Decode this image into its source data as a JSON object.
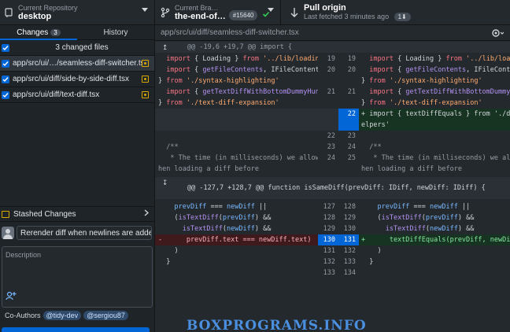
{
  "toolbar": {
    "repo_label": "Current Repository",
    "repo_name": "desktop",
    "branch_label": "Current Bra…",
    "branch_name": "the-end-of…",
    "pr_number": "#15640",
    "pull_title": "Pull origin",
    "pull_subtitle": "Last fetched 3 minutes ago",
    "pull_badge": "1⬇"
  },
  "sidebar": {
    "tabs": [
      {
        "label": "Changes",
        "count": "3"
      },
      {
        "label": "History"
      }
    ],
    "changed_header": "3 changed files",
    "files": [
      {
        "name": "app/src/ui/…/seamless-diff-switcher.tsx"
      },
      {
        "name": "app/src/ui/diff/side-by-side-diff.tsx"
      },
      {
        "name": "app/src/ui/diff/text-diff.tsx"
      }
    ],
    "stashed_label": "Stashed Changes",
    "summary_value": "Rerender diff when newlines are adde",
    "description_placeholder": "Description",
    "coauthors_label": "Co-Authors",
    "coauthors": [
      "@tidy-dev",
      "@sergiou87"
    ]
  },
  "diff": {
    "path": "app/src/ui/diff/seamless-diff-switcher.tsx",
    "hunk1": "@@ -19,6 +19,7 @@ import {",
    "hunk2": "@@ -127,7 +128,7 @@ function isSameDiff(prevDiff: IDiff, newDiff: IDiff) {",
    "watermark": "BOXPROGRAMS.INFO",
    "lines": {
      "l1_left": "  import { Loading } from '../lib/loading'",
      "l1_right": "  import { Loading } from '../lib/loading'",
      "l2_left": "  import { getFileContents, IFileContents",
      "l2b_left": "} from './syntax-highlighting'",
      "l2_right": "  import { getFileContents, IFileContents",
      "l2b_right": "} from './syntax-highlighting'",
      "l3_left": "  import { getTextDiffWithBottomDummyHunk",
      "l3b_left": "} from './text-diff-expansion'",
      "l3_right": "  import { getTextDiffWithBottomDummyHunk",
      "l3b_right": "} from './text-diff-expansion'",
      "add1_right": "+ import { textDiffEquals } from './dif",
      "add1b_right": "elpers'",
      "c1_left": "  /**",
      "c1_right": "  /**",
      "c2_left": "   * The time (in milliseconds) we allow w",
      "c2b_left": "hen loading a diff before",
      "c2_right": "   * The time (in milliseconds) we allo",
      "c2b_right": "hen loading a diff before",
      "b1_left": "    prevDiff === newDiff ||",
      "b1_right": "    prevDiff === newDiff ||",
      "b2_left": "    (isTextDiff(prevDiff) &&",
      "b2_right": "    (isTextDiff(prevDiff) &&",
      "b3_left": "      isTextDiff(newDiff) &&",
      "b3_right": "      isTextDiff(newDiff) &&",
      "b4_left": "-      prevDiff.text === newDiff.text)",
      "b4_right": "+      textDiffEquals(prevDiff, newDiff",
      "b5_left": "    )",
      "b5_right": "    )",
      "b6_left": "  }",
      "b6_right": "  }"
    },
    "line_numbers": {
      "a": [
        "19",
        "19",
        "20",
        "20",
        "21",
        "21",
        "22",
        "22",
        "23",
        "23",
        "24",
        "25",
        "127",
        "128",
        "128",
        "129",
        "129",
        "130",
        "130",
        "131",
        "131",
        "132",
        "132",
        "133",
        "133"
      ]
    }
  }
}
